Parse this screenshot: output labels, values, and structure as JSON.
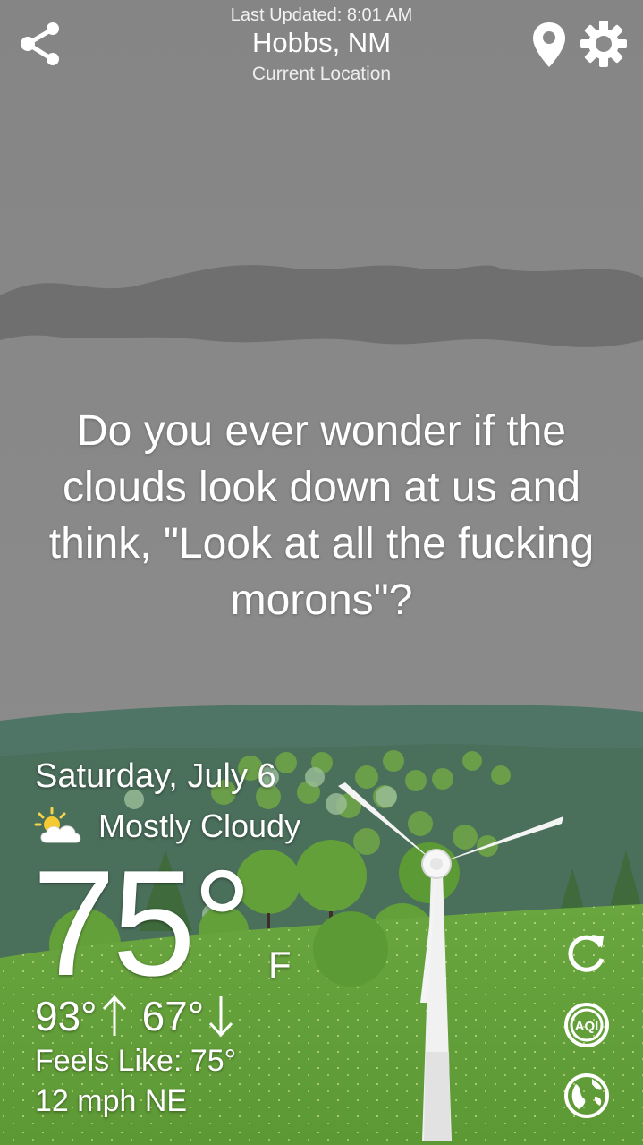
{
  "header": {
    "last_updated": "Last Updated: 8:01 AM",
    "city": "Hobbs, NM",
    "location_label": "Current Location"
  },
  "icons": {
    "share": "share-icon",
    "location": "map-pin-icon",
    "settings": "gear-icon",
    "weather": "partly-cloudy-icon",
    "refresh": "refresh-icon",
    "aqi": "aqi-icon",
    "radar": "radar-icon"
  },
  "quote": "Do you ever wonder if the clouds look down at us and think, \"Look at all the fucking morons\"?",
  "weather": {
    "date": "Saturday, July 6",
    "condition": "Mostly Cloudy",
    "temperature": "75°",
    "unit": "F",
    "high": "93°",
    "low": "67°",
    "feels_like": "Feels Like: 75°",
    "wind": "12 mph NE"
  },
  "actions": {
    "aqi_label": "AQI"
  },
  "colors": {
    "sky": "#8a8a8a",
    "cloud_band": "#6e6e6e",
    "hills": "#4e7060",
    "grass": "#62a03a",
    "tree": "#5e9e36"
  }
}
